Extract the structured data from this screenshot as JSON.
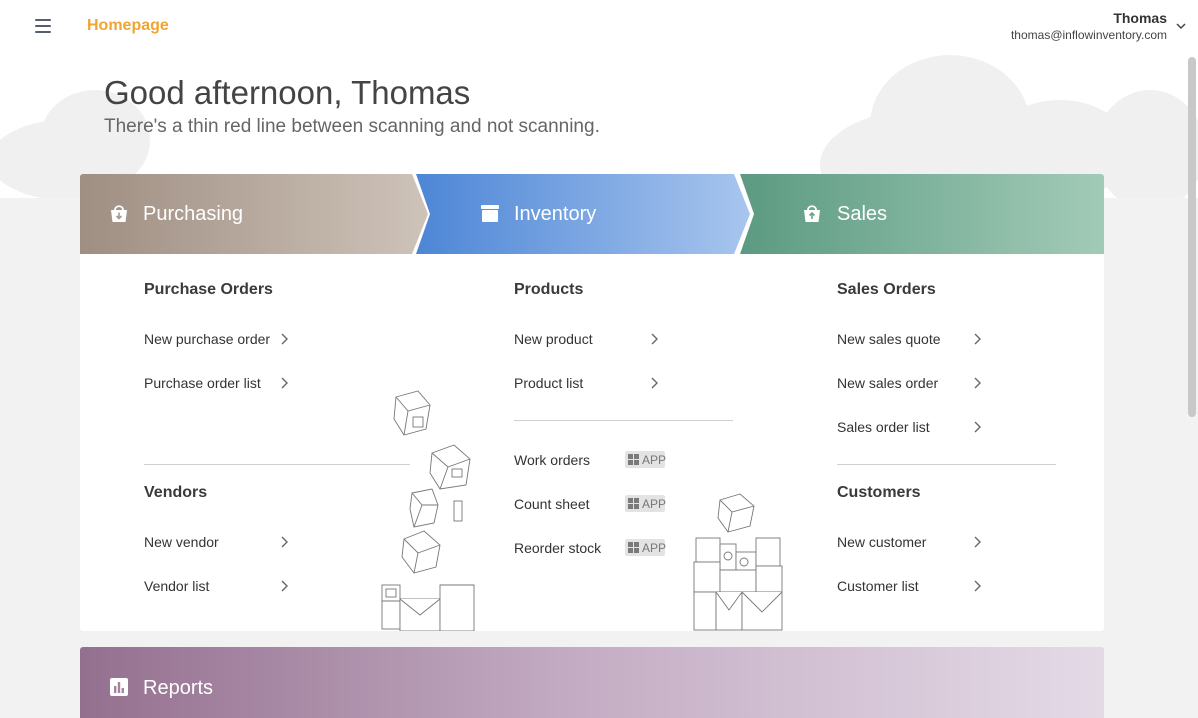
{
  "header": {
    "page_label": "Homepage",
    "user_name": "Thomas",
    "user_email": "thomas@inflowinventory.com"
  },
  "hero": {
    "greeting": "Good afternoon, Thomas",
    "tagline": "There's a thin red line between scanning and not scanning."
  },
  "sections": {
    "purchasing": {
      "title": "Purchasing",
      "icon": "basket-down-icon",
      "groups": [
        {
          "heading": "Purchase Orders",
          "links": [
            "New purchase order",
            "Purchase order list"
          ]
        },
        {
          "heading": "Vendors",
          "links": [
            "New vendor",
            "Vendor list"
          ]
        }
      ]
    },
    "inventory": {
      "title": "Inventory",
      "icon": "box-icon",
      "groups": [
        {
          "heading": "Products",
          "links": [
            "New product",
            "Product list"
          ]
        }
      ],
      "app_links": [
        {
          "label": "Work orders",
          "badge": "APP"
        },
        {
          "label": "Count sheet",
          "badge": "APP"
        },
        {
          "label": "Reorder stock",
          "badge": "APP"
        }
      ]
    },
    "sales": {
      "title": "Sales",
      "icon": "basket-up-icon",
      "groups": [
        {
          "heading": "Sales Orders",
          "links": [
            "New sales quote",
            "New sales order",
            "Sales order list"
          ]
        },
        {
          "heading": "Customers",
          "links": [
            "New customer",
            "Customer list"
          ]
        }
      ]
    },
    "reports": {
      "title": "Reports",
      "icon": "bar-chart-icon"
    }
  },
  "colors": {
    "page_label": "#f0a531",
    "purchasing": "#9f8e82",
    "inventory": "#4d86d6",
    "sales": "#5c9a82",
    "reports": "#94708f"
  }
}
